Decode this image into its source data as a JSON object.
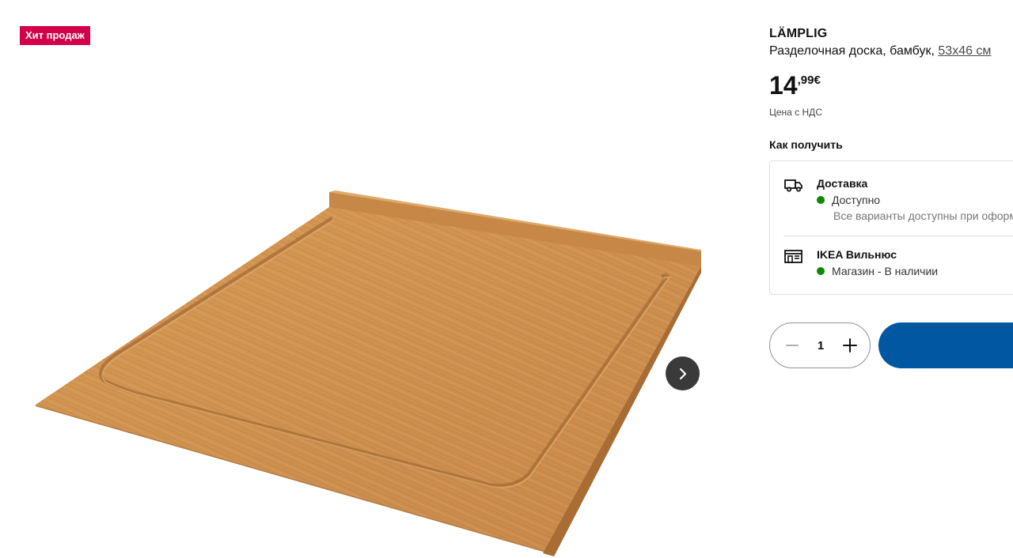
{
  "badge": {
    "label": "Хит продаж",
    "color": "#d3004a"
  },
  "product": {
    "name": "LÄMPLIG",
    "description": "Разделочная доска, бамбук, ",
    "size": "53x46 см",
    "price_int": "14",
    "price_dec": ",99€",
    "vat_note": "Цена с НДС"
  },
  "fulfillment": {
    "title": "Как получить",
    "delivery": {
      "icon": "truck-icon",
      "title": "Доставка",
      "status": "Доступно",
      "note": "Все варианты доступны при оформлении заказа"
    },
    "store": {
      "icon": "store-icon",
      "title": "IKEA Вильнюс",
      "status": "Магазин - В наличии"
    },
    "status_color": "#0a8a00"
  },
  "cart": {
    "quantity": "1",
    "button_color": "#0058a3"
  },
  "gallery": {
    "next_icon": "chevron-right-icon"
  }
}
